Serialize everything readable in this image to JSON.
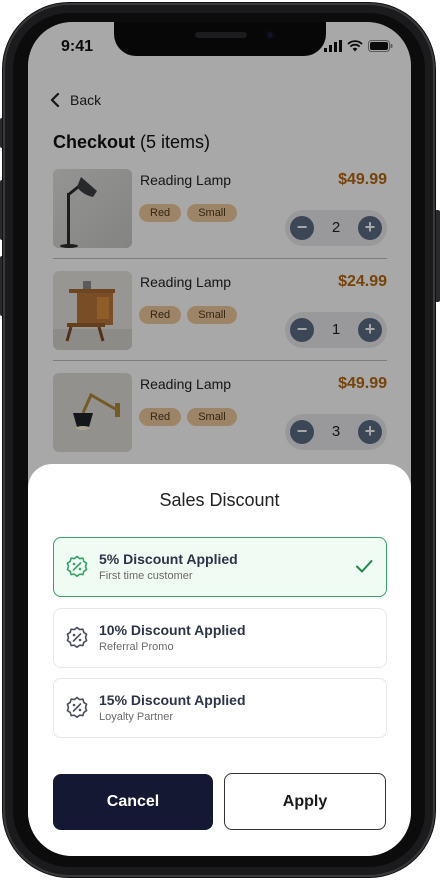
{
  "status": {
    "time": "9:41"
  },
  "nav": {
    "back_label": "Back"
  },
  "checkout": {
    "title": "Checkout",
    "count_text": "(5 items)"
  },
  "items": [
    {
      "name": "Reading Lamp",
      "price": "$49.99",
      "chips": [
        "Red",
        "Small"
      ],
      "qty": "2"
    },
    {
      "name": "Reading Lamp",
      "price": "$24.99",
      "chips": [
        "Red",
        "Small"
      ],
      "qty": "1"
    },
    {
      "name": "Reading Lamp",
      "price": "$49.99",
      "chips": [
        "Red",
        "Small"
      ],
      "qty": "3"
    }
  ],
  "sheet": {
    "title": "Sales Discount",
    "options": [
      {
        "title": "5% Discount Applied",
        "subtitle": "First time customer",
        "selected": true
      },
      {
        "title": "10% Discount Applied",
        "subtitle": "Referral Promo",
        "selected": false
      },
      {
        "title": "15% Discount Applied",
        "subtitle": "Loyalty Partner",
        "selected": false
      }
    ],
    "cancel_label": "Cancel",
    "apply_label": "Apply"
  },
  "colors": {
    "price": "#b4670e",
    "accent_green": "#36a265",
    "dark_button": "#141833",
    "chip": "#eec99c"
  }
}
